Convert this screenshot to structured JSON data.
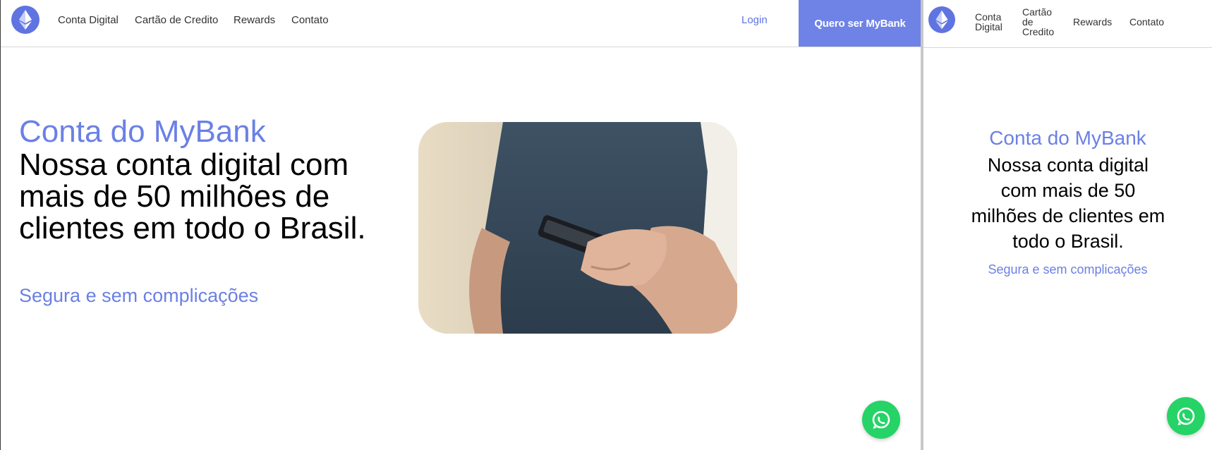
{
  "brand": {
    "accent": "#6b80e5",
    "cta_bg": "#6f83e6",
    "whatsapp": "#25d366"
  },
  "desktop": {
    "nav": {
      "links": [
        "Conta Digital",
        "Cartão de Credito",
        "Rewards",
        "Contato"
      ],
      "login": "Login",
      "cta": "Quero ser MyBank"
    },
    "hero": {
      "eyebrow": "Conta do MyBank",
      "headline": "Nossa conta digital com mais de 50 milhões de clientes em todo o Brasil.",
      "subtitle": "Segura e sem complicações"
    }
  },
  "mobile": {
    "nav": {
      "links": [
        "Conta Digital",
        "Cartão de Credito",
        "Rewards",
        "Contato"
      ]
    },
    "hero": {
      "eyebrow": "Conta do MyBank",
      "headline": "Nossa conta digital com mais de 50 milhões de clientes em todo o Brasil.",
      "subtitle": "Segura e sem complicações"
    }
  },
  "icons": {
    "logo": "ethereum-logo-icon",
    "chat": "whatsapp-icon"
  }
}
